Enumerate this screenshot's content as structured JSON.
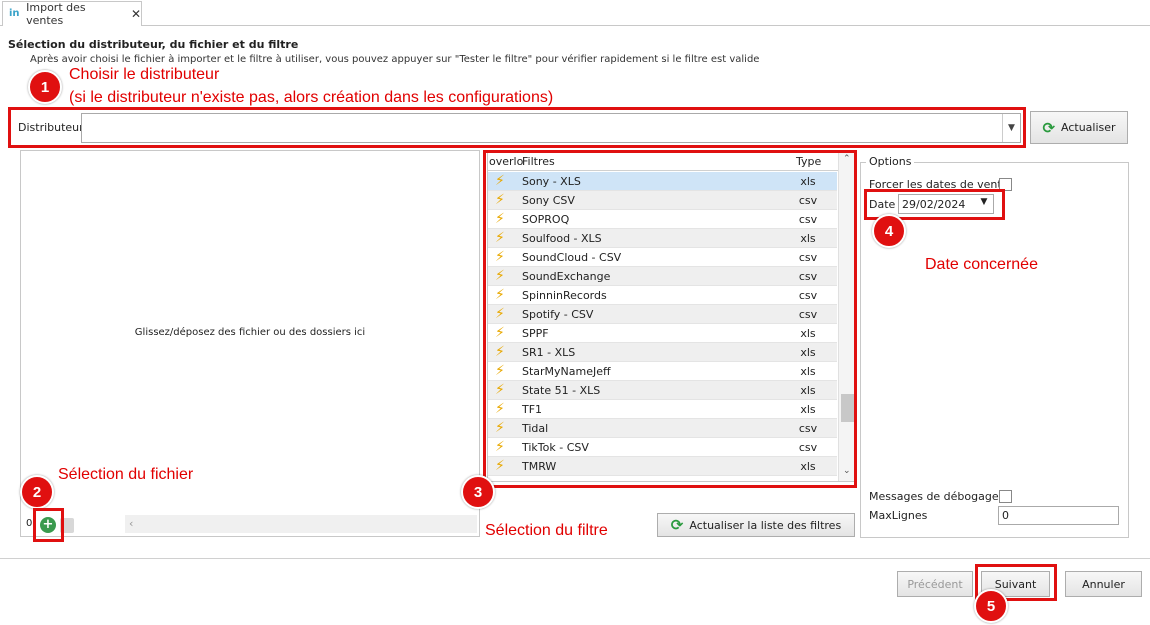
{
  "tab": {
    "icon": "in",
    "label": "Import des ventes",
    "close": "✕"
  },
  "header": {
    "title": "Sélection du distributeur, du fichier et du filtre",
    "description": "Après avoir choisi le fichier à importer et le filtre à utiliser, vous pouvez appuyer sur \"Tester le filtre\" pour vérifier rapidement si le filtre est valide"
  },
  "annotations": {
    "a1_line1": "Choisir le distributeur",
    "a1_line2": "(si le distributeur n'existe pas, alors création dans les configurations)",
    "a2": "Sélection du fichier",
    "a3": "Sélection du filtre",
    "a4": "Date concernée",
    "badges": [
      "1",
      "2",
      "3",
      "4",
      "5"
    ]
  },
  "distributor": {
    "label": "Distributeur",
    "value": "",
    "refresh_label": "Actualiser"
  },
  "dropzone": {
    "text": "Glissez/déposez des fichier ou des dossiers ici",
    "count": "0"
  },
  "filters": {
    "columns": [
      "overlo",
      "Filtres",
      "Type"
    ],
    "rows": [
      {
        "name": "Sony -  XLS",
        "type": "xls"
      },
      {
        "name": "Sony CSV",
        "type": "csv"
      },
      {
        "name": "SOPROQ",
        "type": "csv"
      },
      {
        "name": "Soulfood - XLS",
        "type": "xls"
      },
      {
        "name": "SoundCloud - CSV",
        "type": "csv"
      },
      {
        "name": "SoundExchange",
        "type": "csv"
      },
      {
        "name": "SpinninRecords",
        "type": "csv"
      },
      {
        "name": "Spotify - CSV",
        "type": "csv"
      },
      {
        "name": "SPPF",
        "type": "xls"
      },
      {
        "name": "SR1 - XLS",
        "type": "xls"
      },
      {
        "name": "StarMyNameJeff",
        "type": "xls"
      },
      {
        "name": "State 51 - XLS",
        "type": "xls"
      },
      {
        "name": "TF1",
        "type": "xls"
      },
      {
        "name": "Tidal",
        "type": "csv"
      },
      {
        "name": "TikTok - CSV",
        "type": "csv"
      },
      {
        "name": "TMRW",
        "type": "xls"
      }
    ],
    "refresh_label": "Actualiser la liste des filtres"
  },
  "options": {
    "legend": "Options",
    "force_dates_label": "Forcer les dates de vente",
    "date_label": "Date",
    "date_value": "29/02/2024",
    "debug_label": "Messages de débogage",
    "maxlines_label": "MaxLignes",
    "maxlines_value": "0"
  },
  "footer": {
    "prev": "Précédent",
    "next": "Suivant",
    "cancel": "Annuler"
  },
  "colors": {
    "annotation": "#e01010",
    "accent": "#3aa3c9",
    "selected_row": "#cfe4f7"
  }
}
